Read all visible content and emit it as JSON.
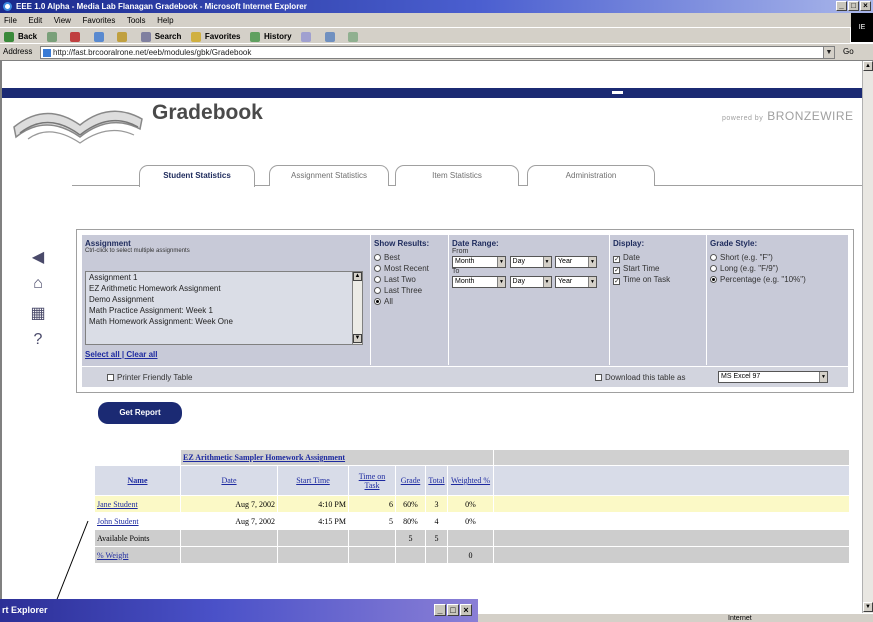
{
  "browser": {
    "title": "EEE 1.0 Alpha - Media Lab Flanagan Gradebook - Microsoft Internet Explorer",
    "window_buttons": [
      "_",
      "□",
      "×"
    ],
    "menu": [
      "File",
      "Edit",
      "View",
      "Favorites",
      "Tools",
      "Help"
    ],
    "toolbar": [
      "Back",
      "Forward",
      "Stop",
      "Refresh",
      "Home",
      "Search",
      "Favorites",
      "History",
      "Mail",
      "Print",
      "Edit"
    ],
    "address_label": "Address",
    "address_value": "http://fast.brcooralrone.net/eeb/modules/gbk/Gradebook",
    "go_label": "Go",
    "throbber": "IE"
  },
  "page": {
    "title": "Gradebook",
    "powered_small": "powered by",
    "powered_brand": "BRONZEWIRE",
    "tabs": [
      "Student Statistics",
      "Assignment Statistics",
      "Item Statistics",
      "Administration"
    ]
  },
  "side_icons": [
    "back-arrow-icon",
    "home-icon",
    "grid-icon",
    "help-icon"
  ],
  "side_glyphs": [
    "◀",
    "⌂",
    "▦",
    "?"
  ],
  "filters": {
    "assignment": {
      "title": "Assignment",
      "subtitle": "Ctrl-click to select multiple assignments",
      "items": [
        "Assignment 1",
        "EZ Arithmetic Homework Assignment",
        "Demo Assignment",
        "Math Practice Assignment: Week 1",
        "Math Homework Assignment: Week One"
      ],
      "select_all": "Select all",
      "clear_all": "Clear all"
    },
    "show_results": {
      "title": "Show Results:",
      "options": [
        "Best",
        "Most Recent",
        "Last Two",
        "Last Three",
        "All"
      ],
      "selected": "All"
    },
    "date_range": {
      "title": "Date Range:",
      "from_label": "From",
      "to_label": "To",
      "month": "Month",
      "day": "Day",
      "year": "Year"
    },
    "display": {
      "title": "Display:",
      "options": [
        "Date",
        "Start Time",
        "Time on Task"
      ],
      "checked": [
        true,
        true,
        true
      ]
    },
    "grade_style": {
      "title": "Grade Style:",
      "options": [
        "Short (e.g. \"F\")",
        "Long (e.g. \"F/9\")",
        "Percentage (e.g. \"10%\")"
      ],
      "selected": "Percentage (e.g. \"10%\")"
    },
    "printer_friendly": "Printer Friendly Table",
    "download_label": "Download this table as",
    "download_format": "MS Excel 97"
  },
  "get_report": "Get Report",
  "results": {
    "assignment_title": "EZ Arithmetic Sampler Homework Assignment",
    "headers": [
      "Name",
      "Date",
      "Start Time",
      "Time on Task",
      "Grade",
      "Total",
      "Weighted %"
    ],
    "rows": [
      {
        "name": "Jane Student",
        "date": "Aug 7, 2002",
        "time": "4:10 PM",
        "task": "6",
        "grade": "60%",
        "total": "3",
        "weighted": "0%"
      },
      {
        "name": "John Student",
        "date": "Aug 7, 2002",
        "time": "4:15 PM",
        "task": "5",
        "grade": "80%",
        "total": "4",
        "weighted": "0%"
      }
    ],
    "available_points_label": "Available Points",
    "available_points": [
      "5",
      "5"
    ],
    "pct_weight_label": "% Weight",
    "pct_weight": "0"
  },
  "popup": {
    "title": "Microsoft Internet Explorer",
    "visible_title": "rt Explorer"
  },
  "status": {
    "zone": "Internet"
  }
}
